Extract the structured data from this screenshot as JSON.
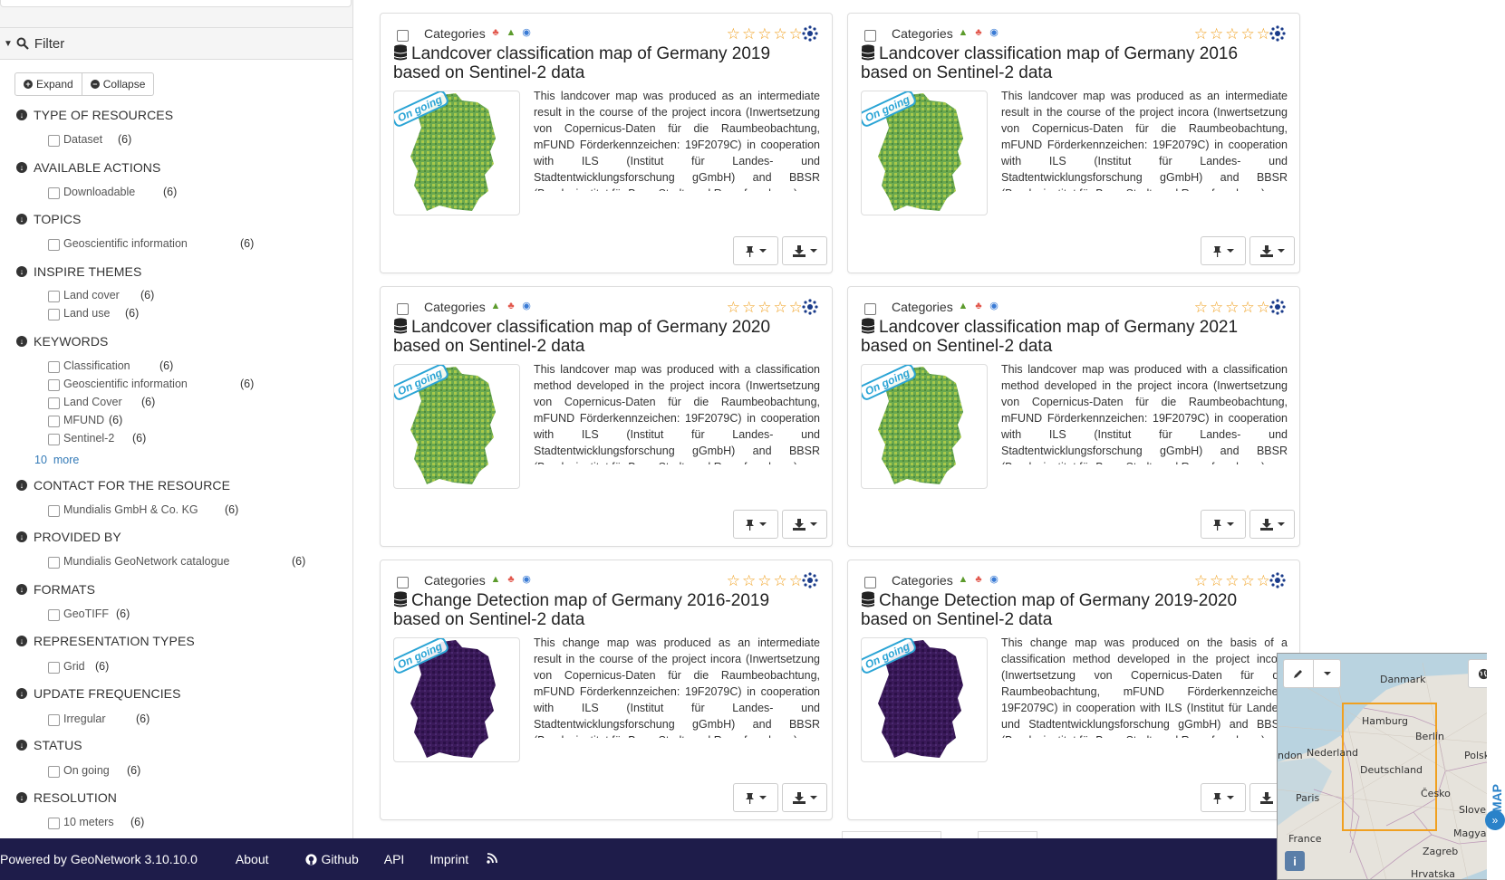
{
  "filter": {
    "title": "Filter",
    "expand_label": "Expand",
    "collapse_label": "Collapse",
    "facets": [
      {
        "title": "TYPE OF RESOURCES",
        "items": [
          {
            "label": "Dataset",
            "count": "(6)"
          }
        ]
      },
      {
        "title": "AVAILABLE ACTIONS",
        "items": [
          {
            "label": "Downloadable",
            "count": "(6)"
          }
        ]
      },
      {
        "title": "TOPICS",
        "items": [
          {
            "label": "Geoscientific information",
            "count": "(6)"
          }
        ]
      },
      {
        "title": "INSPIRE THEMES",
        "items": [
          {
            "label": "Land cover",
            "count": "(6)"
          },
          {
            "label": "Land use",
            "count": "(6)"
          }
        ]
      },
      {
        "title": "KEYWORDS",
        "items": [
          {
            "label": "Classification",
            "count": "(6)"
          },
          {
            "label": "Geoscientific information",
            "count": "(6)"
          },
          {
            "label": "Land Cover",
            "count": "(6)"
          },
          {
            "label": "MFUND",
            "count": "(6)"
          },
          {
            "label": "Sentinel-2",
            "count": "(6)"
          }
        ]
      },
      {
        "title": "CONTACT FOR THE RESOURCE",
        "items": [
          {
            "label": "Mundialis GmbH & Co. KG",
            "count": "(6)"
          }
        ]
      },
      {
        "title": "PROVIDED BY",
        "items": [
          {
            "label": "Mundialis GeoNetwork catalogue",
            "count": "(6)"
          }
        ]
      },
      {
        "title": "FORMATS",
        "items": [
          {
            "label": "GeoTIFF",
            "count": "(6)"
          }
        ]
      },
      {
        "title": "REPRESENTATION TYPES",
        "items": [
          {
            "label": "Grid",
            "count": "(6)"
          }
        ]
      },
      {
        "title": "UPDATE FREQUENCIES",
        "items": [
          {
            "label": "Irregular",
            "count": "(6)"
          }
        ]
      },
      {
        "title": "STATUS",
        "items": [
          {
            "label": "On going",
            "count": "(6)"
          }
        ]
      },
      {
        "title": "RESOLUTION",
        "items": [
          {
            "label": "10 meters",
            "count": "(6)"
          }
        ]
      }
    ],
    "more_count": "10",
    "more_label": "more"
  },
  "cards": [
    {
      "categories_label": "Categories",
      "title": "Landcover classification map of Germany 2019 based on Sentinel-2 data",
      "status": "On going",
      "abstract": "This landcover map was produced as an intermediate result in the course of the project incora (Inwertsetzung von Copernicus-Daten für die Raumbeobachtung, mFUND Förderkennzeichen: 19F2079C) in cooperation with ILS (Institut für Landes- und Stadtentwicklungsforschung gGmbH) and BBSR (Bundesinstitut für Bau-, Stadt- und Raumforschung)",
      "map_style": "green"
    },
    {
      "categories_label": "Categories",
      "title": "Landcover classification map of Germany 2016 based on Sentinel-2 data",
      "status": "On going",
      "abstract": "This landcover map was produced as an intermediate result in the course of the project incora (Inwertsetzung von Copernicus-Daten für die Raumbeobachtung, mFUND Förderkennzeichen: 19F2079C) in cooperation with ILS (Institut für Landes- und Stadtentwicklungsforschung gGmbH) and BBSR (Bundesinstitut für Bau-, Stadt- und Raumforschung)",
      "map_style": "green"
    },
    {
      "categories_label": "Categories",
      "title": "Landcover classification map of Germany 2020 based on Sentinel-2 data",
      "status": "On going",
      "abstract": "This landcover map was produced with a classification method developed in the project incora (Inwertsetzung von Copernicus-Daten für die Raumbeobachtung, mFUND Förderkennzeichen: 19F2079C) in cooperation with ILS (Institut für Landes- und Stadtentwicklungsforschung gGmbH) and BBSR (Bundesinstitut für Bau-, Stadt- und Raumforschung)",
      "map_style": "green"
    },
    {
      "categories_label": "Categories",
      "title": "Landcover classification map of Germany 2021 based on Sentinel-2 data",
      "status": "On going",
      "abstract": "This landcover map was produced with a classification method developed in the project incora (Inwertsetzung von Copernicus-Daten für die Raumbeobachtung, mFUND Förderkennzeichen: 19F2079C) in cooperation with ILS (Institut für Landes- und Stadtentwicklungsforschung gGmbH) and BBSR (Bundesinstitut für Bau-, Stadt- und Raumforschung)",
      "map_style": "green"
    },
    {
      "categories_label": "Categories",
      "title": "Change Detection map of Germany 2016-2019 based on Sentinel-2 data",
      "status": "On going",
      "abstract": "This change map was produced as an intermediate result in the course of the project incora (Inwertsetzung von Copernicus-Daten für die Raumbeobachtung, mFUND Förderkennzeichen: 19F2079C) in cooperation with ILS (Institut für Landes- und Stadtentwicklungsforschung gGmbH) and BBSR (Bundesinstitut für Bau-, Stadt- und Raumforschung)",
      "map_style": "purple"
    },
    {
      "categories_label": "Categories",
      "title": "Change Detection map of Germany 2019-2020 based on Sentinel-2 data",
      "status": "On going",
      "abstract": "This change map was produced on the basis of a classification method developed in the project incora (Inwertsetzung von Copernicus-Daten für die Raumbeobachtung, mFUND Förderkennzeichen: 19F2079C) in cooperation with ILS (Institut für Landes- und Stadtentwicklungsforschung gGmbH) and BBSR (Bundesinstitut für Bau-, Stadt- und Raumforschung)",
      "map_style": "purple"
    }
  ],
  "footer": {
    "powered": "Powered by GeoNetwork 3.10.10.0",
    "about": "About",
    "github": "Github",
    "api": "API",
    "imprint": "Imprint"
  },
  "map": {
    "label": "MAP",
    "cities": [
      "Danmark",
      "Hamburg",
      "Berlin",
      "Nederland",
      "Polska",
      "Deutschland",
      "ndon",
      "Paris",
      "Česko",
      "Slover",
      "France",
      "Magyaror",
      "Zagreb",
      "Hrvatska"
    ]
  },
  "colors": {
    "footer_bg": "#1e1c4a",
    "accent": "#337ab7",
    "status_badge": "#2aa4d5",
    "star": "#f0a020",
    "bbox": "#f0a020"
  }
}
